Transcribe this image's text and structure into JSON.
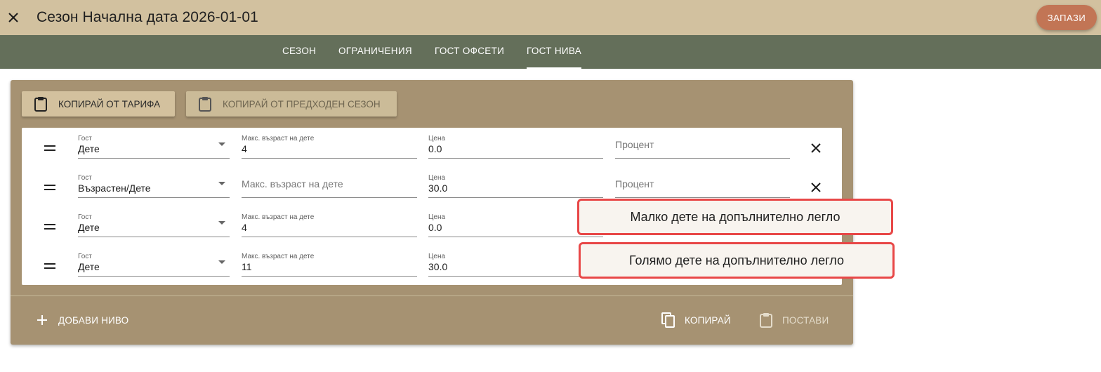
{
  "header": {
    "close_icon": "close-icon",
    "title": "Сезон Начална дата 2026-01-01",
    "save_label": "ЗАПАЗИ",
    "save_color": "#c27555"
  },
  "tabs": [
    {
      "label": "СЕЗОН",
      "active": false
    },
    {
      "label": "ОГРАНИЧЕНИЯ",
      "active": false
    },
    {
      "label": "ГОСТ ОФСЕТИ",
      "active": false
    },
    {
      "label": "ГОСТ НИВА",
      "active": true
    }
  ],
  "toolbar": {
    "copy_tariff_label": "КОПИРАЙ ОТ ТАРИФА",
    "copy_prev_season_label": "КОПИРАЙ ОТ ПРЕДХОДЕН СЕЗОН",
    "icon": "clipboard-icon"
  },
  "field_labels": {
    "guest": "Гост",
    "max_age": "Макс. възраст на дете",
    "price": "Цена",
    "percent": "Процент"
  },
  "rows": [
    {
      "guest": "Дете",
      "max_age": "4",
      "price": "0.0",
      "percent": ""
    },
    {
      "guest": "Възрастен/Дете",
      "max_age": "",
      "price": "30.0",
      "percent": ""
    },
    {
      "guest": "Дете",
      "max_age": "4",
      "price": "0.0",
      "percent": ""
    },
    {
      "guest": "Дете",
      "max_age": "11",
      "price": "30.0",
      "percent": ""
    }
  ],
  "dropdown_options": [
    "Малко дете на допълнително легло",
    "Голямо дете на допълнително легло"
  ],
  "footer": {
    "add_level_label": "ДОБАВИ НИВО",
    "copy_label": "КОПИРАЙ",
    "paste_label": "ПОСТАВИ"
  },
  "colors": {
    "topbar": "#d2c19f",
    "tabbar": "#646f5a",
    "card": "#a69272",
    "highlight_border": "#e84747"
  }
}
